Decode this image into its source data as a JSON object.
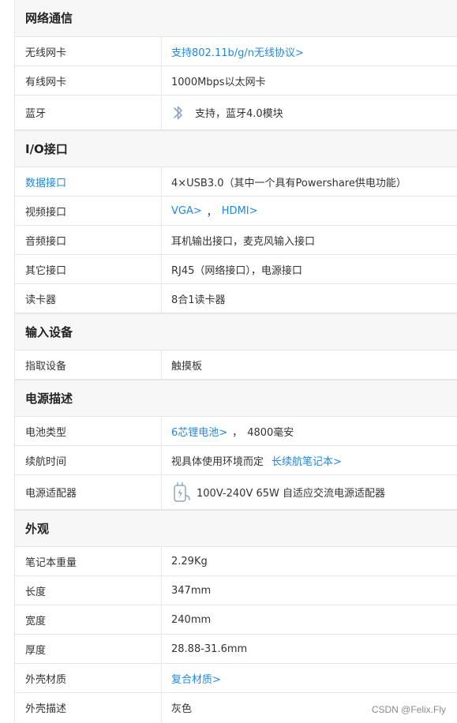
{
  "network": {
    "title": "网络通信",
    "wireless": {
      "label": "无线网卡",
      "value": "支持802.11b/g/n无线协议>"
    },
    "wired": {
      "label": "有线网卡",
      "value": "1000Mbps以太网卡"
    },
    "bluetooth": {
      "label": "蓝牙",
      "value": "支持，蓝牙4.0模块",
      "icon": "bluetooth-icon"
    }
  },
  "io": {
    "title": "I/O接口",
    "data_port": {
      "label": "数据接口",
      "value": "4×USB3.0（其中一个具有Powershare供电功能）"
    },
    "video_port": {
      "label": "视频接口",
      "vga": "VGA>",
      "sep": "，",
      "hdmi": "HDMI>"
    },
    "audio_port": {
      "label": "音频接口",
      "value": "耳机输出接口，麦克风输入接口"
    },
    "other_port": {
      "label": "其它接口",
      "value": "RJ45（网络接口），电源接口"
    },
    "card_reader": {
      "label": "读卡器",
      "value": "8合1读卡器"
    }
  },
  "input": {
    "title": "输入设备",
    "pointing": {
      "label": "指取设备",
      "value": "触摸板"
    }
  },
  "power": {
    "title": "电源描述",
    "battery": {
      "label": "电池类型",
      "link": "6芯锂电池>",
      "sep": "，",
      "value": "4800毫安"
    },
    "battery_life": {
      "label": "续航时间",
      "value": "视具体使用环境而定",
      "link": "长续航笔记本>"
    },
    "adapter": {
      "label": "电源适配器",
      "value": "100V-240V 65W 自适应交流电源适配器",
      "icon": "power-adapter-icon"
    }
  },
  "appearance": {
    "title": "外观",
    "weight": {
      "label": "笔记本重量",
      "value": "2.29Kg"
    },
    "length": {
      "label": "长度",
      "value": "347mm"
    },
    "width": {
      "label": "宽度",
      "value": "240mm"
    },
    "thickness": {
      "label": "厚度",
      "value": "28.88-31.6mm"
    },
    "shell_material": {
      "label": "外壳材质",
      "value": "复合材质>"
    },
    "shell_desc": {
      "label": "外壳描述",
      "value": "灰色"
    }
  },
  "watermark": "CSDN @Felix.Fly",
  "colors": {
    "link": "#1e88e5",
    "section_bg": "#f7f7f7",
    "border": "#e6e6e6"
  }
}
